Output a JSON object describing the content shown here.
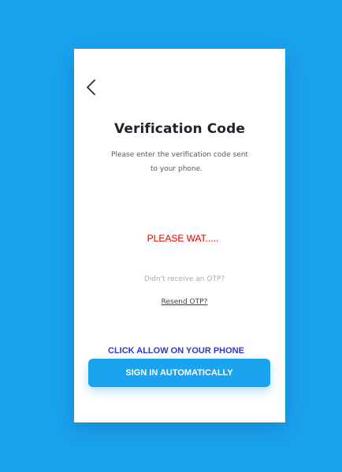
{
  "colors": {
    "background": "#1aa3ee",
    "card": "#ffffff",
    "title": "#23232b",
    "waiting": "#e00000",
    "allow_hint": "#3236c8",
    "button": "#1aa3ee",
    "button_text": "#ffffff"
  },
  "header": {
    "back_icon": "chevron-left-icon"
  },
  "verification": {
    "title": "Verification Code",
    "subtitle_line1": "Please enter the verification code sent",
    "subtitle_line2": "to your phone.",
    "status": "PLEASE WAT.....",
    "no_otp_text": "Didn't receive an OTP?",
    "resend_label": "Resend OTP?"
  },
  "auto_sign_in": {
    "hint": "CLICK ALLOW ON YOUR PHONE",
    "button_label": "SIGN IN AUTOMATICALLY"
  }
}
